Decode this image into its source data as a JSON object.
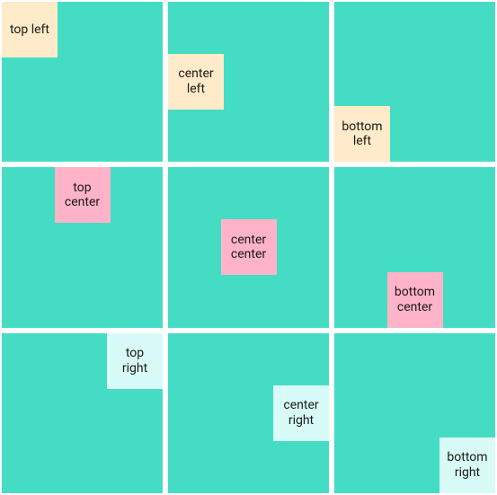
{
  "grid": {
    "rows": [
      {
        "cells": [
          {
            "label": "top left",
            "color": "cream"
          },
          {
            "label": "center\nleft",
            "color": "cream"
          },
          {
            "label": "bottom\nleft",
            "color": "cream"
          }
        ]
      },
      {
        "cells": [
          {
            "label": "top\ncenter",
            "color": "pink"
          },
          {
            "label": "center\ncenter",
            "color": "pink"
          },
          {
            "label": "bottom\ncenter",
            "color": "pink"
          }
        ]
      },
      {
        "cells": [
          {
            "label": "top\nright",
            "color": "mint"
          },
          {
            "label": "center\nright",
            "color": "mint"
          },
          {
            "label": "bottom\nright",
            "color": "mint"
          }
        ]
      }
    ]
  }
}
